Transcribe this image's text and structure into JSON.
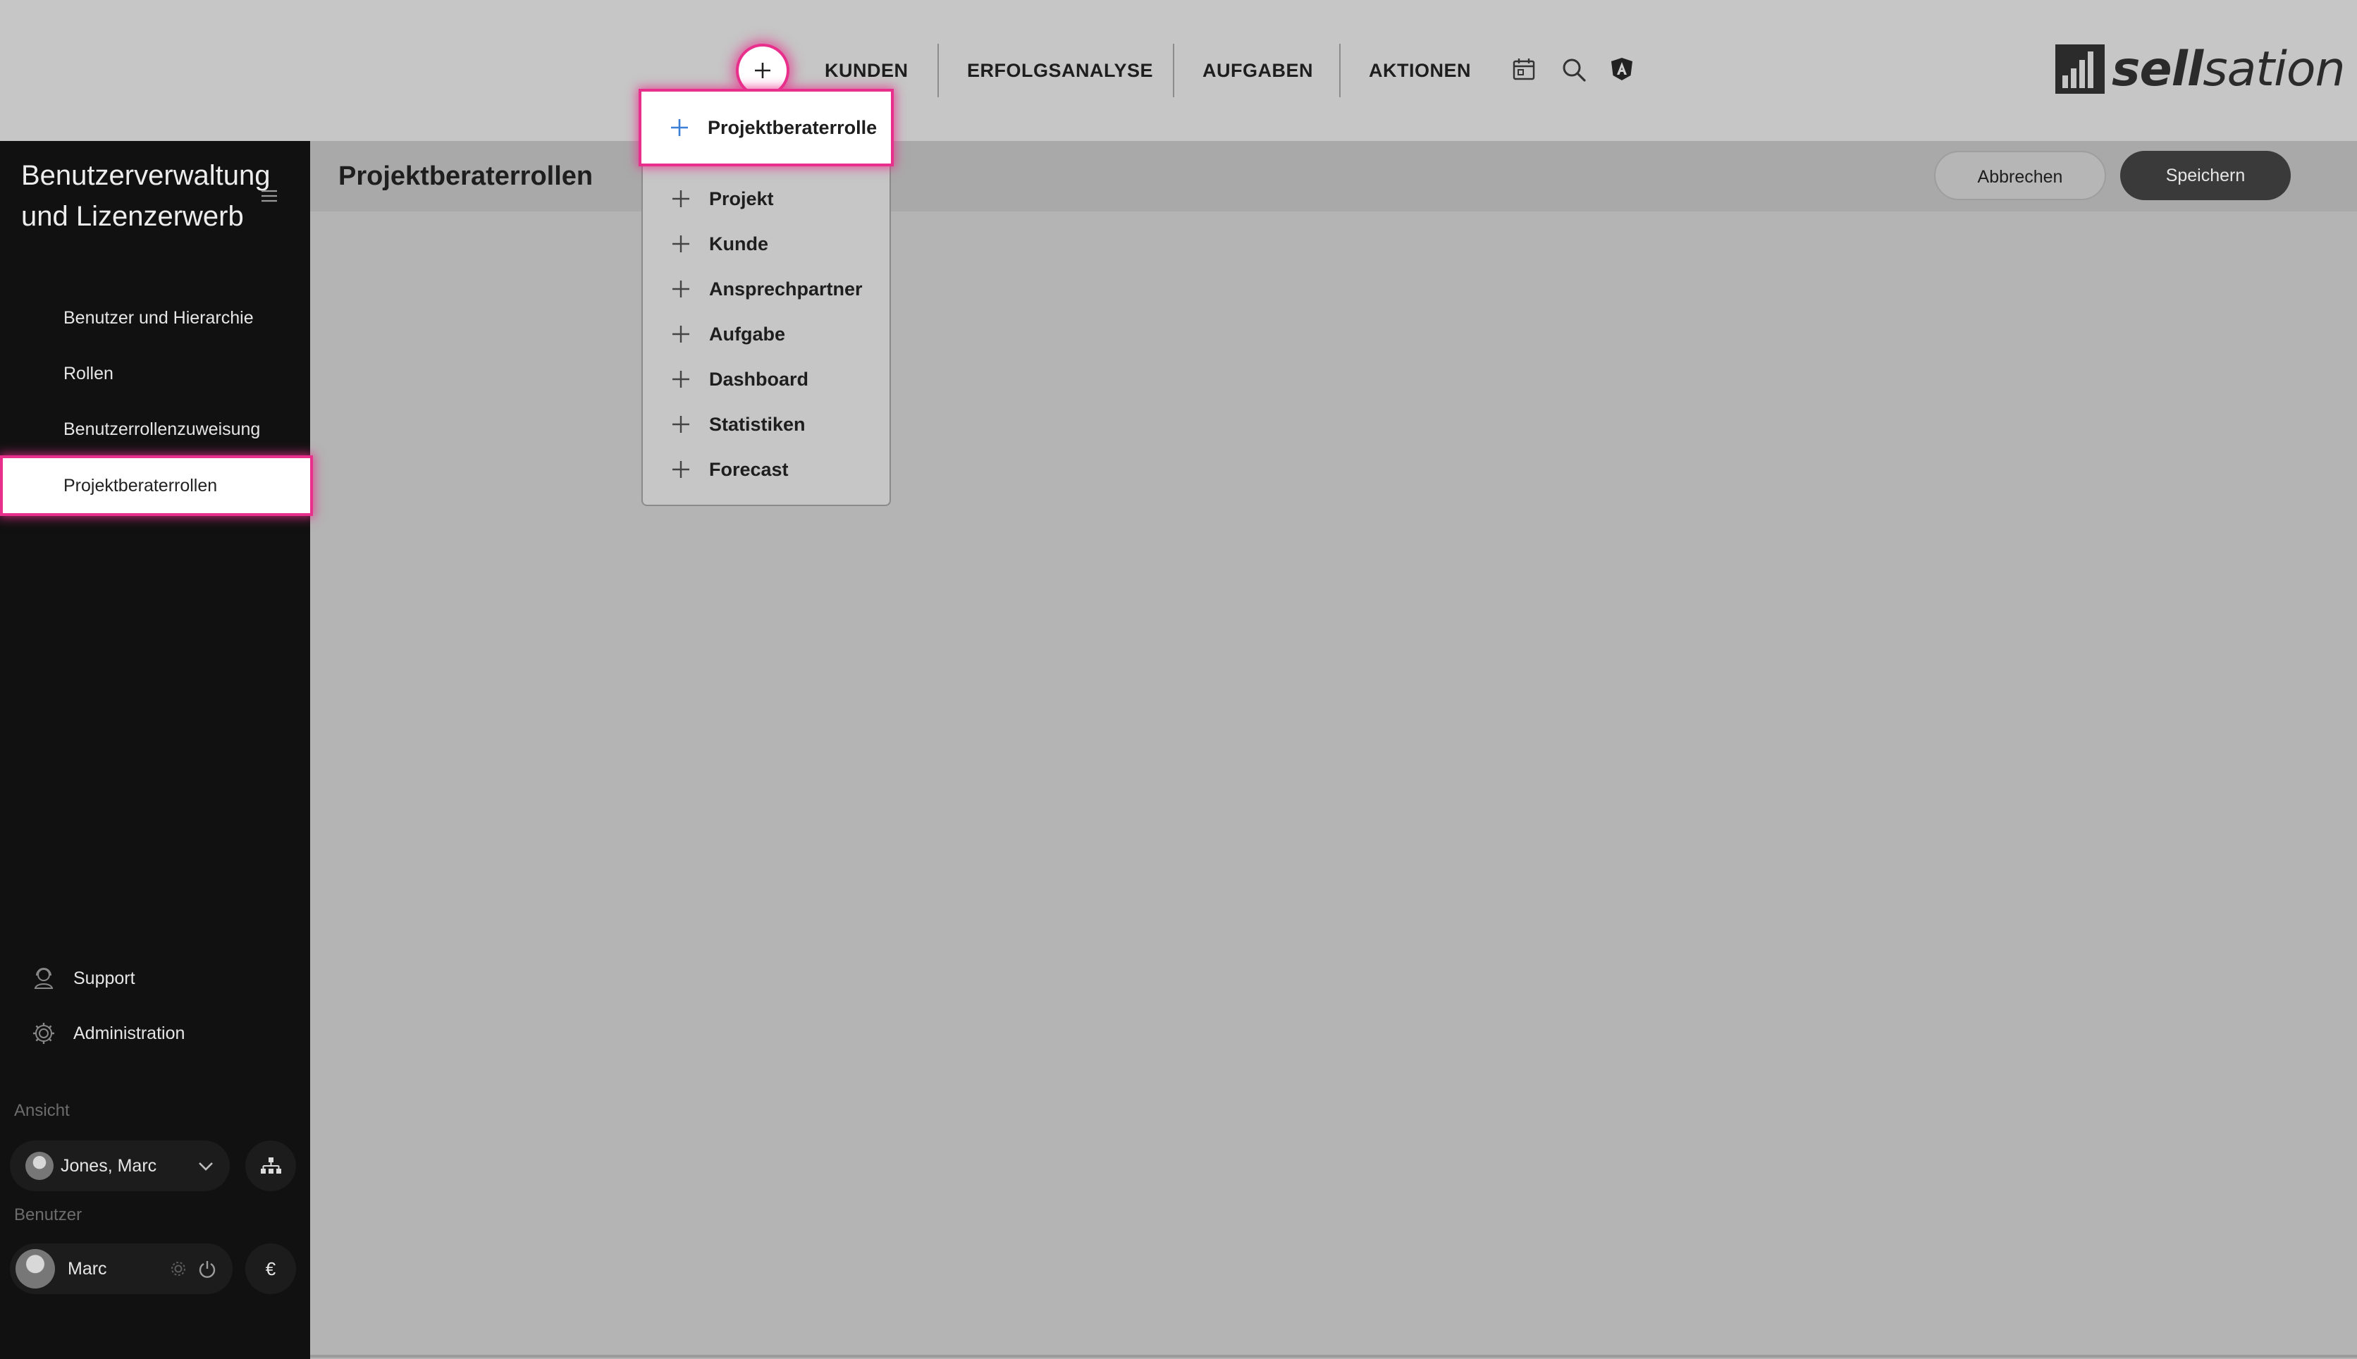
{
  "topnav": {
    "items": [
      {
        "label": "KUNDEN"
      },
      {
        "label": "ERFOLGSANALYSE"
      },
      {
        "label": "AUFGABEN"
      },
      {
        "label": "AKTIONEN"
      }
    ],
    "icons": [
      "calendar-icon",
      "search-icon",
      "angular-shield-icon"
    ],
    "logo": {
      "bold": "sell",
      "rest": "sation"
    }
  },
  "sidebar": {
    "title": "Benutzerverwaltung und Lizenzerwerb",
    "items": [
      {
        "label": "Benutzer und Hierarchie"
      },
      {
        "label": "Rollen"
      },
      {
        "label": "Benutzerrollenzuweisung"
      },
      {
        "label": "Projektberaterrollen",
        "active": true
      }
    ],
    "support": "Support",
    "administration": "Administration",
    "ansicht_label": "Ansicht",
    "ansicht_user": "Jones, Marc",
    "benutzer_label": "Benutzer",
    "benutzer_name": "Marc",
    "currency_symbol": "€"
  },
  "header": {
    "title": "Projektberaterrollen",
    "cancel": "Abbrechen",
    "save": "Speichern"
  },
  "dropdown": {
    "active_item": "Projektberaterrolle",
    "items": [
      "Projekt",
      "Kunde",
      "Ansprechpartner",
      "Aufgabe",
      "Dashboard",
      "Statistiken",
      "Forecast"
    ]
  },
  "colors": {
    "highlight": "#e8308c",
    "accent_plus": "#3b7fd6",
    "sidebar_bg": "#111111",
    "topbar_bg": "#c6c6c6"
  }
}
